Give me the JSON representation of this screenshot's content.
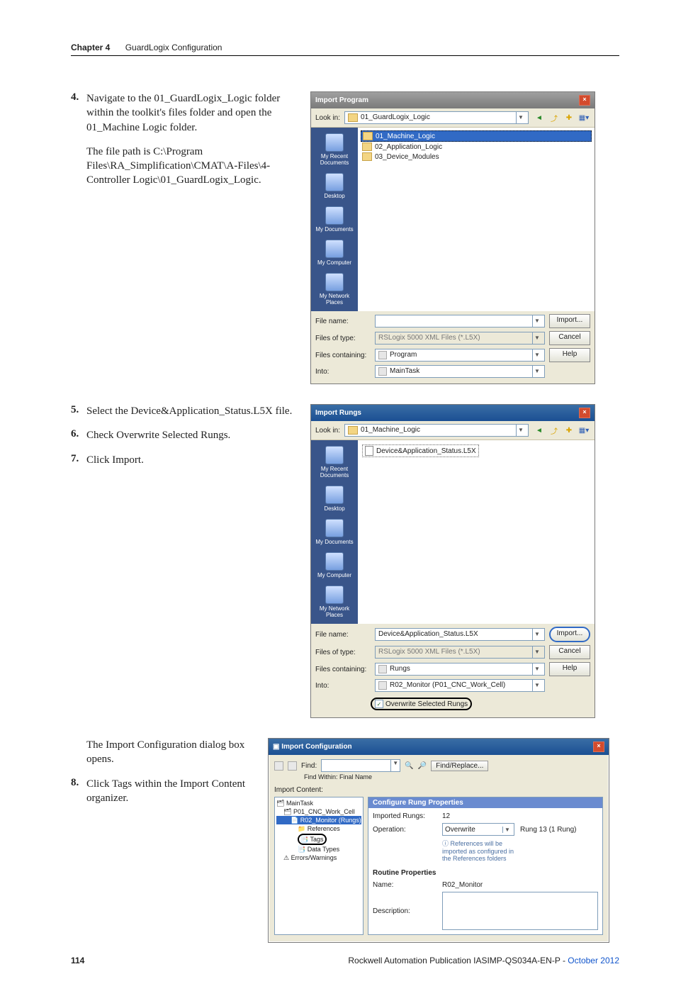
{
  "chapter": {
    "label": "Chapter 4",
    "title": "GuardLogix Configuration"
  },
  "steps": {
    "s4": "Navigate to the 01_GuardLogix_Logic folder within the toolkit's files folder and open the 01_Machine Logic folder.",
    "s4b": "The file path is C:\\Program Files\\RA_Simplification\\CMAT\\A-Files\\4-Controller Logic\\01_GuardLogix_Logic.",
    "s5": "Select the Device&Application_Status.L5X file.",
    "s6": "Check Overwrite Selected Rungs.",
    "s7": "Click Import.",
    "s7b": "The Import Configuration dialog box opens.",
    "s8": "Click Tags within the Import Content organizer."
  },
  "dialog1": {
    "title": "Import Program",
    "look_in_label": "Look in:",
    "look_in_value": "01_GuardLogix_Logic",
    "places": [
      "My Recent Documents",
      "Desktop",
      "My Documents",
      "My Computer",
      "My Network Places"
    ],
    "folders": [
      "01_Machine_Logic",
      "02_Application_Logic",
      "03_Device_Modules"
    ],
    "file_name_label": "File name:",
    "file_name_value": "",
    "file_type_label": "Files of type:",
    "file_type_value": "RSLogix 5000 XML Files (*.L5X)",
    "files_containing_label": "Files containing:",
    "files_containing_value": "Program",
    "into_label": "Into:",
    "into_value": "MainTask",
    "import_btn": "Import...",
    "cancel_btn": "Cancel",
    "help_btn": "Help"
  },
  "dialog2": {
    "title": "Import Rungs",
    "look_in_label": "Look in:",
    "look_in_value": "01_Machine_Logic",
    "places": [
      "My Recent Documents",
      "Desktop",
      "My Documents",
      "My Computer",
      "My Network Places"
    ],
    "files": [
      "Device&Application_Status.L5X"
    ],
    "file_name_label": "File name:",
    "file_name_value": "Device&Application_Status.L5X",
    "file_type_label": "Files of type:",
    "file_type_value": "RSLogix 5000 XML Files (*.L5X)",
    "files_containing_label": "Files containing:",
    "files_containing_value": "Rungs",
    "into_label": "Into:",
    "into_value": "R02_Monitor (P01_CNC_Work_Cell)",
    "overwrite_label": "Overwrite Selected Rungs",
    "import_btn": "Import...",
    "cancel_btn": "Cancel",
    "help_btn": "Help"
  },
  "dialog3": {
    "title": "Import Configuration",
    "find_label": "Find:",
    "find_replace_btn": "Find/Replace...",
    "find_within": "Find Within: Final Name",
    "import_content_label": "Import Content:",
    "tree": {
      "root": "MainTask",
      "program": "P01_CNC_Work_Cell",
      "routine": "R02_Monitor (Rungs)",
      "references": "References",
      "tags": "Tags",
      "datatypes": "Data Types",
      "errors": "Errors/Warnings"
    },
    "section1": "Configure Rung Properties",
    "imported_rungs_label": "Imported Rungs:",
    "imported_rungs_value": "12",
    "operation_label": "Operation:",
    "operation_value": "Overwrite",
    "operation_right": "Rung 13 (1 Rung)",
    "operation_note": "References will be imported as configured in the References folders",
    "section2": "Routine Properties",
    "name_label": "Name:",
    "name_value": "R02_Monitor",
    "description_label": "Description:"
  },
  "footer": {
    "page": "114",
    "pub": "Rockwell Automation Publication IASIMP-QS034A-EN-P - ",
    "date": "October 2012"
  }
}
